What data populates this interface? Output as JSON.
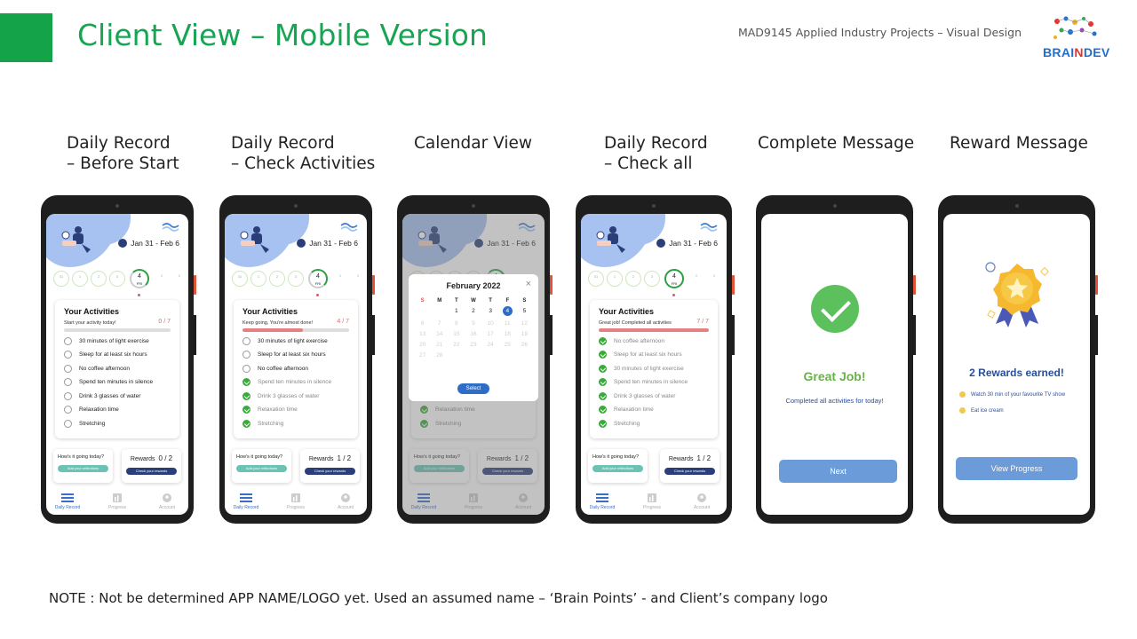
{
  "header": {
    "title": "Client View – Mobile Version",
    "course": "MAD9145 Applied Industry Projects – Visual Design",
    "logo_text_a": "BRAI",
    "logo_text_b": "N",
    "logo_text_c": "DEV"
  },
  "captions": [
    {
      "line1": "Daily Record",
      "line2": "– Before Start"
    },
    {
      "line1": "Daily Record",
      "line2": "– Check Activities"
    },
    {
      "line1": "Calendar View",
      "line2": ""
    },
    {
      "line1": "Daily Record",
      "line2": "– Check all"
    },
    {
      "line1": "Complete Message",
      "line2": ""
    },
    {
      "line1": "Reward Message",
      "line2": ""
    }
  ],
  "app": {
    "date_range": "Jan 31 - Feb 6",
    "activities_title": "Your Activities",
    "week_days": [
      "31",
      "1",
      "2",
      "3",
      "4",
      "5",
      "6"
    ],
    "current_day_label": "4",
    "current_day_abbr": "FRI",
    "screens": [
      {
        "subtitle": "Start your activity today!",
        "count": "0 / 7",
        "progress": 0.0,
        "items": [
          {
            "label": "30 minutes of light exercise",
            "done": false
          },
          {
            "label": "Sleep for at least six hours",
            "done": false
          },
          {
            "label": "No coffee afternoon",
            "done": false
          },
          {
            "label": "Spend ten minutes in silence",
            "done": false
          },
          {
            "label": "Drink 3 glasses of water",
            "done": false
          },
          {
            "label": "Relaxation time",
            "done": false
          },
          {
            "label": "Stretching",
            "done": false
          }
        ],
        "rewards": "0 / 2"
      },
      {
        "subtitle": "Keep going, You're almost done!",
        "count": "4 / 7",
        "progress": 0.57,
        "items": [
          {
            "label": "30 minutes of light exercise",
            "done": false
          },
          {
            "label": "Sleep for at least six hours",
            "done": false
          },
          {
            "label": "No coffee afternoon",
            "done": false
          },
          {
            "label": "Spend ten minutes in silence",
            "done": true
          },
          {
            "label": "Drink 3 glasses of water",
            "done": true
          },
          {
            "label": "Relaxation time",
            "done": true
          },
          {
            "label": "Stretching",
            "done": true
          }
        ],
        "rewards": "1 / 2"
      },
      {
        "subtitle": "Great job! Completed all activities",
        "count": "7 / 7",
        "progress": 1.0,
        "items": [
          {
            "label": "No coffee afternoon",
            "done": true
          },
          {
            "label": "Sleep for at least six hours",
            "done": true
          },
          {
            "label": "30 minutes of light exercise",
            "done": true
          },
          {
            "label": "Spend ten minutes in silence",
            "done": true
          },
          {
            "label": "Drink 3 glasses of water",
            "done": true
          },
          {
            "label": "Relaxation time",
            "done": true
          },
          {
            "label": "Stretching",
            "done": true
          }
        ],
        "rewards": "1 / 2"
      }
    ],
    "calendar_items": [
      "Relaxation time",
      "Stretching"
    ],
    "how_going": "How's it going today?",
    "add_reflections": "Add your reflections",
    "rewards_label": "Rewards",
    "check_rewards": "Check your rewards",
    "tabs": [
      "Daily Record",
      "Progress",
      "Account"
    ]
  },
  "calendar": {
    "title": "February 2022",
    "close": "×",
    "weekday_heads": [
      "S",
      "M",
      "T",
      "W",
      "T",
      "F",
      "S"
    ],
    "days": [
      "",
      "",
      "1",
      "2",
      "3",
      "4",
      "5",
      "6",
      "7",
      "8",
      "9",
      "10",
      "11",
      "12",
      "13",
      "14",
      "15",
      "16",
      "17",
      "18",
      "19",
      "20",
      "21",
      "22",
      "23",
      "24",
      "25",
      "26",
      "27",
      "28",
      "",
      "",
      "",
      "",
      ""
    ],
    "selected": "4",
    "select_label": "Select",
    "rewards_value": "1 / 2"
  },
  "complete": {
    "heading": "Great Job!",
    "message": "Completed all activities for today!",
    "next_label": "Next"
  },
  "reward": {
    "heading": "2 Rewards earned!",
    "items": [
      "Watch 30 min of your favourite TV show",
      "Eat ice cream"
    ],
    "button": "View Progress"
  },
  "note": "NOTE : Not be determined APP NAME/LOGO yet. Used an assumed name – ‘Brain Points’ - and Client’s company logo",
  "colors": {
    "brand_green": "#18a553",
    "accent_blue": "#2e6dc7",
    "check_green": "#3aaa3a",
    "progress_red": "#e98080"
  }
}
